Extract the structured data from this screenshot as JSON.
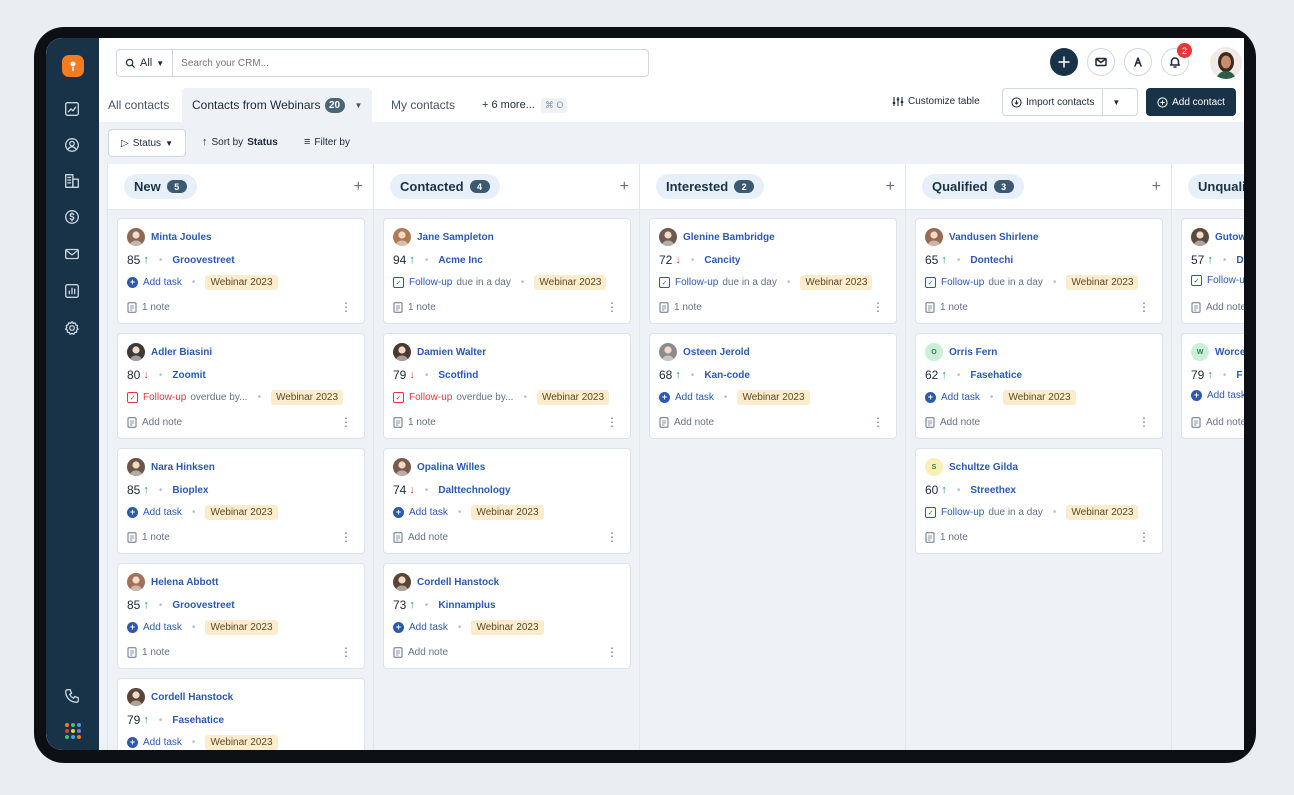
{
  "search": {
    "scope": "All",
    "placeholder": "Search your CRM..."
  },
  "notifications": {
    "count": "2"
  },
  "tabs": [
    {
      "label": "All contacts"
    },
    {
      "label": "Contacts from Webinars",
      "count": "20"
    },
    {
      "label": "My contacts"
    },
    {
      "label": "+ 6 more...",
      "shortcut": "⌘ O"
    }
  ],
  "toolbar": {
    "customize": "Customize table",
    "import": "Import contacts",
    "add_contact": "Add contact"
  },
  "filters": {
    "status": "Status",
    "sort_prefix": "Sort by",
    "sort_field": "Status",
    "filter": "Filter by"
  },
  "colors": {
    "sidebar": "#183247",
    "accent": "#2a59b3",
    "brand": "#f47b20",
    "tag": "#fbeccd"
  },
  "columns": [
    {
      "title": "New",
      "count": "5",
      "cards": [
        {
          "name": "Minta Joules",
          "score": "85",
          "dir": "up",
          "company": "Groovestreet",
          "task": "Add task",
          "task_type": "add",
          "due": "",
          "tag": "Webinar 2023",
          "note": "1 note",
          "avatar": "#8a6a55"
        },
        {
          "name": "Adler Biasini",
          "score": "80",
          "dir": "down",
          "company": "Zoomit",
          "task": "Follow-up",
          "task_type": "overdue",
          "due": "overdue by...",
          "tag": "Webinar 2023",
          "note": "Add note",
          "avatar": "#3b3b3b"
        },
        {
          "name": "Nara Hinksen",
          "score": "85",
          "dir": "up",
          "company": "Bioplex",
          "task": "Add task",
          "task_type": "add",
          "due": "",
          "tag": "Webinar 2023",
          "note": "1 note",
          "avatar": "#6a5548"
        },
        {
          "name": "Helena Abbott",
          "score": "85",
          "dir": "up",
          "company": "Groovestreet",
          "task": "Add task",
          "task_type": "add",
          "due": "",
          "tag": "Webinar 2023",
          "note": "1 note",
          "avatar": "#a0705a"
        },
        {
          "name": "Cordell Hanstock",
          "score": "79",
          "dir": "up",
          "company": "Fasehatice",
          "task": "Add task",
          "task_type": "add",
          "due": "",
          "tag": "Webinar 2023",
          "note": "",
          "avatar": "#5a4436"
        }
      ]
    },
    {
      "title": "Contacted",
      "count": "4",
      "cards": [
        {
          "name": "Jane Sampleton",
          "score": "94",
          "dir": "up",
          "company": "Acme Inc",
          "task": "Follow-up",
          "task_type": "due",
          "due": "due in a day",
          "tag": "Webinar 2023",
          "note": "1 note",
          "avatar": "#b07a55"
        },
        {
          "name": "Damien Walter",
          "score": "79",
          "dir": "down",
          "company": "Scotfind",
          "task": "Follow-up",
          "task_type": "overdue",
          "due": "overdue by...",
          "tag": "Webinar 2023",
          "note": "1 note",
          "avatar": "#4a3a30"
        },
        {
          "name": "Opalina Willes",
          "score": "74",
          "dir": "down",
          "company": "Dalttechnology",
          "task": "Add task",
          "task_type": "add",
          "due": "",
          "tag": "Webinar 2023",
          "note": "Add note",
          "avatar": "#7a5a48"
        },
        {
          "name": "Cordell Hanstock",
          "score": "73",
          "dir": "up",
          "company": "Kinnamplus",
          "task": "Add task",
          "task_type": "add",
          "due": "",
          "tag": "Webinar 2023",
          "note": "Add note",
          "avatar": "#5a4436"
        }
      ]
    },
    {
      "title": "Interested",
      "count": "2",
      "cards": [
        {
          "name": "Glenine Bambridge",
          "score": "72",
          "dir": "down",
          "company": "Cancity",
          "task": "Follow-up",
          "task_type": "due",
          "due": "due in a day",
          "tag": "Webinar 2023",
          "note": "1 note",
          "avatar": "#6d5a50"
        },
        {
          "name": "Osteen Jerold",
          "score": "68",
          "dir": "up",
          "company": "Kan-code",
          "task": "Add task",
          "task_type": "add",
          "due": "",
          "tag": "Webinar 2023",
          "note": "Add note",
          "avatar": "#8c8c8c"
        }
      ]
    },
    {
      "title": "Qualified",
      "count": "3",
      "cards": [
        {
          "name": "Vandusen Shirlene",
          "score": "65",
          "dir": "up",
          "company": "Dontechi",
          "task": "Follow-up",
          "task_type": "due",
          "due": "due in a day",
          "tag": "Webinar 2023",
          "note": "1 note",
          "avatar": "#9a6a50"
        },
        {
          "name": "Orris Fern",
          "score": "62",
          "dir": "up",
          "company": "Fasehatice",
          "task": "Add task",
          "task_type": "add",
          "due": "",
          "tag": "Webinar 2023",
          "note": "Add note",
          "avatar_initial": "O",
          "avatar": "#c9efd6"
        },
        {
          "name": "Schultze Gilda",
          "score": "60",
          "dir": "up",
          "company": "Streethex",
          "task": "Follow-up",
          "task_type": "due",
          "due": "due in a day",
          "tag": "Webinar 2023",
          "note": "1 note",
          "avatar_initial": "S",
          "avatar": "#fbf0b4"
        }
      ]
    },
    {
      "title": "Unqualified",
      "count": "",
      "cards": [
        {
          "name": "Gutowski",
          "score": "57",
          "dir": "up",
          "company": "D",
          "task": "Follow-up",
          "task_type": "due",
          "due": "",
          "tag": "",
          "note": "Add note",
          "avatar": "#5a4a40"
        },
        {
          "name": "Worcester",
          "score": "79",
          "dir": "up",
          "company": "F",
          "task": "Add task",
          "task_type": "add",
          "due": "",
          "tag": "",
          "note": "Add note",
          "avatar_initial": "W",
          "avatar": "#c9efd6"
        }
      ]
    }
  ]
}
